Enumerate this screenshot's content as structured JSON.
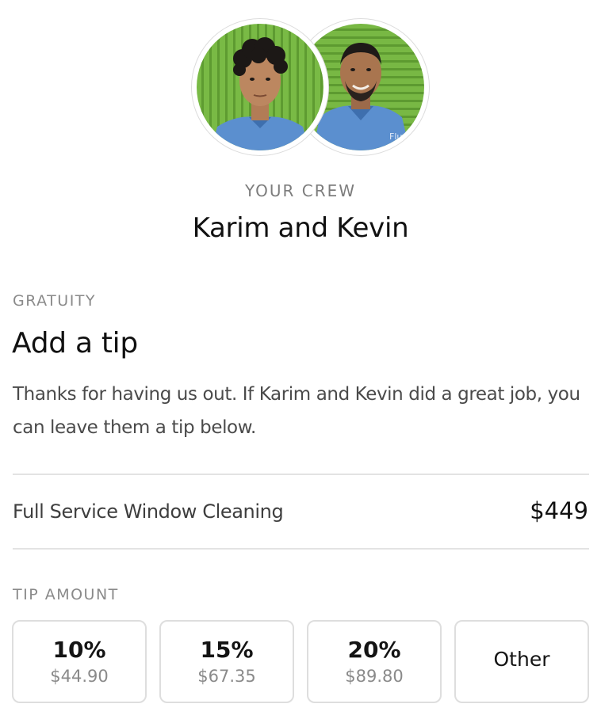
{
  "crew": {
    "label": "YOUR CREW",
    "names": "Karim and Kevin",
    "members": [
      {
        "name": "Karim",
        "shirt_text": ""
      },
      {
        "name": "Kevin",
        "shirt_text": "Flu"
      }
    ]
  },
  "gratuity": {
    "section_label": "GRATUITY",
    "title": "Add a tip",
    "description": "Thanks for having us out. If Karim and Kevin did a great job, you can leave them a tip below."
  },
  "service": {
    "name": "Full Service Window Cleaning",
    "price": "$449"
  },
  "tip_amount": {
    "label": "TIP AMOUNT",
    "options": [
      {
        "percent": "10%",
        "amount": "$44.90"
      },
      {
        "percent": "15%",
        "amount": "$67.35"
      },
      {
        "percent": "20%",
        "amount": "$89.80"
      }
    ],
    "other_label": "Other"
  },
  "colors": {
    "background": "#ffffff",
    "muted_text": "#8a8a8a",
    "divider": "#e3e3e3",
    "photo_background_green": "#72b43f",
    "crew_shirt_blue": "#5b8fcf"
  }
}
